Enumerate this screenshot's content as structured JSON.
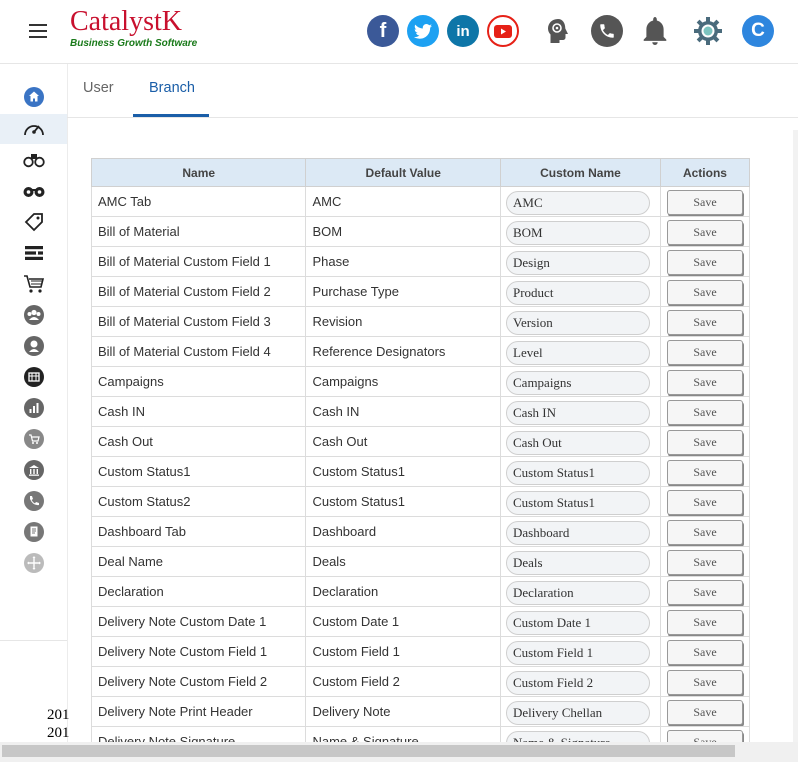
{
  "header": {
    "brand_name": "CatalystK",
    "tagline": "Business Growth Software",
    "avatar_letter": "C",
    "social": [
      {
        "icon": "facebook-icon",
        "color": "#3b5998",
        "glyph": "f"
      },
      {
        "icon": "twitter-icon",
        "color": "#1da1f2",
        "glyph": "t"
      },
      {
        "icon": "linkedin-icon",
        "color": "#0e76a8",
        "glyph": "in"
      },
      {
        "icon": "youtube-icon",
        "color": "#e62117",
        "glyph": "▶"
      }
    ],
    "tools": [
      "idea-head-icon",
      "phone-icon",
      "bell-icon",
      "settings-gear-icon"
    ]
  },
  "tabs": [
    {
      "label": "User",
      "active": false
    },
    {
      "label": "Branch",
      "active": true
    }
  ],
  "sidebar": {
    "items": [
      "home-icon",
      "dashboard-gauge-icon",
      "binoculars-icon",
      "glasses-icon",
      "tag-icon",
      "list-icon",
      "cart-icon",
      "team-icon",
      "support-agent-icon",
      "cash-register-icon",
      "bar-chart-icon",
      "shopping-cart-icon",
      "bank-icon",
      "call-icon",
      "documents-icon",
      "move-icon"
    ],
    "years": [
      "201",
      "201"
    ]
  },
  "table": {
    "headers": [
      "Name",
      "Default Value",
      "Custom Name",
      "Actions"
    ],
    "save_label": "Save",
    "rows": [
      {
        "name": "AMC Tab",
        "default": "AMC",
        "custom": "AMC"
      },
      {
        "name": "Bill of Material",
        "default": "BOM",
        "custom": "BOM"
      },
      {
        "name": "Bill of Material Custom Field 1",
        "default": "Phase",
        "custom": "Design"
      },
      {
        "name": "Bill of Material Custom Field 2",
        "default": "Purchase Type",
        "custom": "Product"
      },
      {
        "name": "Bill of Material Custom Field 3",
        "default": "Revision",
        "custom": "Version"
      },
      {
        "name": "Bill of Material Custom Field 4",
        "default": "Reference Designators",
        "custom": "Level"
      },
      {
        "name": "Campaigns",
        "default": "Campaigns",
        "custom": "Campaigns"
      },
      {
        "name": "Cash IN",
        "default": "Cash IN",
        "custom": "Cash IN"
      },
      {
        "name": "Cash Out",
        "default": "Cash Out",
        "custom": "Cash Out"
      },
      {
        "name": "Custom Status1",
        "default": "Custom Status1",
        "custom": "Custom Status1"
      },
      {
        "name": "Custom Status2",
        "default": "Custom Status1",
        "custom": "Custom Status1"
      },
      {
        "name": "Dashboard Tab",
        "default": "Dashboard",
        "custom": "Dashboard"
      },
      {
        "name": "Deal Name",
        "default": "Deals",
        "custom": "Deals"
      },
      {
        "name": "Declaration",
        "default": "Declaration",
        "custom": "Declaration"
      },
      {
        "name": "Delivery Note Custom Date 1",
        "default": "Custom Date 1",
        "custom": "Custom Date 1"
      },
      {
        "name": "Delivery Note Custom Field 1",
        "default": "Custom Field 1",
        "custom": "Custom Field 1"
      },
      {
        "name": "Delivery Note Custom Field 2",
        "default": "Custom Field 2",
        "custom": "Custom Field 2"
      },
      {
        "name": "Delivery Note Print Header",
        "default": "Delivery Note",
        "custom": "Delivery Chellan"
      },
      {
        "name": "Delivery Note Signature",
        "default": "Name & Signature",
        "custom": "Name & Signature"
      }
    ]
  }
}
